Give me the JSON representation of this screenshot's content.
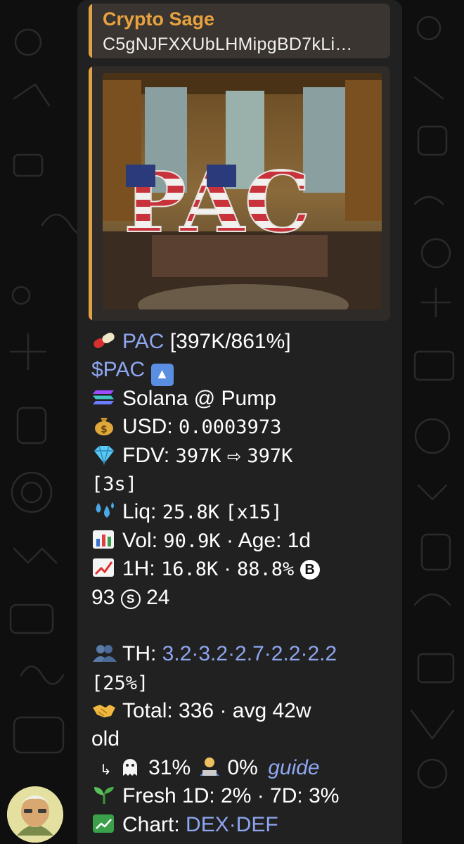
{
  "reply": {
    "name": "Crypto Sage",
    "text": "C5gNJFXXUbLHMipgBD7kLi…"
  },
  "media": {
    "title": "PAC"
  },
  "message": {
    "token_symbol": "PAC",
    "token_stats": "[397K/861%]",
    "ticker": "$PAC",
    "up_icon": "▲",
    "chain": "Solana @ Pump",
    "usd_label": "USD:",
    "usd_value": "0.0003973",
    "fdv_label": "FDV:",
    "fdv_from": "397K",
    "fdv_arrow": "⇨",
    "fdv_to": "397K",
    "fdv_time": "[3s]",
    "liq_label": "Liq:",
    "liq_value": "25.8K",
    "liq_mult": "[x15]",
    "vol_label": "Vol:",
    "vol_value": "90.9K",
    "age_text": "· Age: 1d",
    "h1_label": "1H:",
    "h1_value": "16.8K",
    "h1_sep": "·",
    "h1_pct": "88.8%",
    "b_glyph": "B",
    "b_value": "93",
    "s_glyph": "S",
    "s_value": "24",
    "th_label": "TH:",
    "th_values": "3.2·3.2·2.7·2.2·2.2",
    "th_pct": "[25%]",
    "total_label": "Total: 336",
    "total_avg": "· avg 42w",
    "total_old": "old",
    "sub_arrow": "↳",
    "ghost_pct": "31%",
    "dev_pct": "0%",
    "guide_link": "guide",
    "fresh_text": "Fresh 1D: 2% · 7D: 3%",
    "chart_label": "Chart:",
    "chart_links": "DEX·DEF"
  },
  "icons": {
    "pill": "pill-icon",
    "up": "up-arrow-button-icon",
    "solana": "solana-icon",
    "money": "money-bag-icon",
    "gem": "gem-icon",
    "droplets": "droplets-icon",
    "bar_chart": "bar-chart-icon",
    "trend": "trend-up-icon",
    "users": "users-icon",
    "handshake": "handshake-icon",
    "ghost": "ghost-icon",
    "technologist": "technologist-icon",
    "seedling": "seedling-icon",
    "chart": "chart-yen-icon"
  },
  "colors": {
    "accent_orange": "#e0a043",
    "link_blue": "#8ea6f0",
    "bubble_bg": "#212121",
    "page_bg": "#0f0f10"
  }
}
